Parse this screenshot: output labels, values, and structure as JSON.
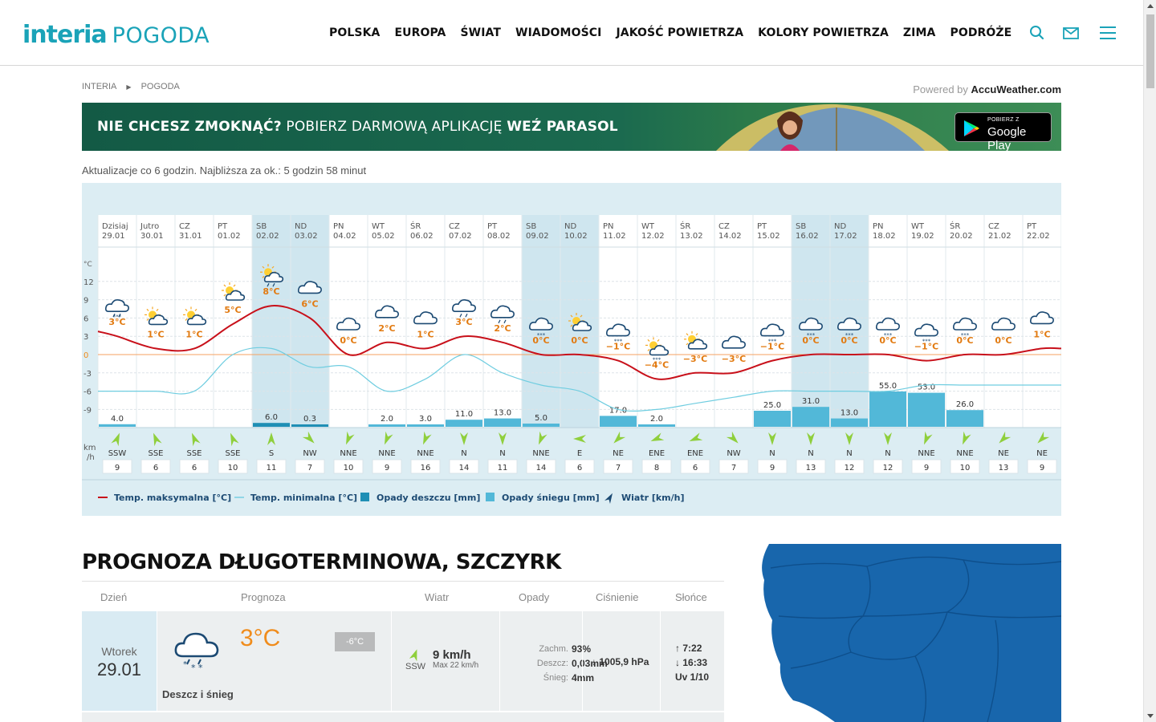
{
  "header": {
    "logo_brand": "interia",
    "logo_section": "POGODA",
    "nav": [
      "POLSKA",
      "EUROPA",
      "ŚWIAT",
      "WIADOMOŚCI",
      "JAKOŚĆ POWIETRZA",
      "KOLORY POWIETRZA",
      "ZIMA",
      "PODRÓŻE"
    ],
    "icons": [
      "search-icon",
      "mail-icon",
      "menu-icon"
    ]
  },
  "breadcrumb": [
    "INTERIA",
    "POGODA"
  ],
  "powered_by": {
    "prefix": "Powered by",
    "brand": "AccuWeather.com"
  },
  "banner": {
    "text_bold1": "NIE CHCESZ ZMOKNĄĆ?",
    "text_normal": "POBIERZ DARMOWĄ APLIKACJĘ",
    "text_bold2": "WEŹ PARASOL",
    "store_small": "POBIERZ Z",
    "store_big": "Google Play"
  },
  "updates_text": "Aktualizacje co 6 godzin. Najbliższa za ok.: 5 godzin 58 minut",
  "colors": {
    "max_line": "#c8101a",
    "min_line": "#6fcde0",
    "rain_bar": "#1f8fb5",
    "snow_bar": "#52b8d8",
    "accent": "#1aa3b8",
    "weekend_col": "#cfe6ef"
  },
  "chart_data": {
    "type": "line",
    "temp_unit": "°C",
    "wind_unit_1": "km",
    "wind_unit_2": "/h",
    "y_ticks": [
      "12",
      "9",
      "6",
      "3",
      "0",
      "-3",
      "-6",
      "-9"
    ],
    "ylim": [
      -12,
      15
    ],
    "days": [
      {
        "d": "Dzisiaj",
        "date": "29.01",
        "max": 3,
        "min": -6,
        "label": "3°C",
        "icon": "rain-snow-icon",
        "precip": 4.0,
        "ptype": "snow",
        "wdir": "SSW",
        "wspd": 9,
        "weekend": false
      },
      {
        "d": "Jutro",
        "date": "30.01",
        "max": 1,
        "min": -6,
        "label": "1°C",
        "icon": "partly-sunny-icon",
        "precip": 0,
        "ptype": "none",
        "wdir": "SSE",
        "wspd": 6,
        "weekend": false
      },
      {
        "d": "CZ",
        "date": "31.01",
        "max": 1,
        "min": -6,
        "label": "1°C",
        "icon": "partly-sunny-icon",
        "precip": 0,
        "ptype": "none",
        "wdir": "SSE",
        "wspd": 6,
        "weekend": false
      },
      {
        "d": "PT",
        "date": "01.02",
        "max": 5,
        "min": 0,
        "label": "5°C",
        "icon": "partly-sunny-icon",
        "precip": 0,
        "ptype": "none",
        "wdir": "SSE",
        "wspd": 10,
        "weekend": false
      },
      {
        "d": "SB",
        "date": "02.02",
        "max": 8,
        "min": 1,
        "label": "8°C",
        "icon": "sun-rain-icon",
        "precip": 6.0,
        "ptype": "rain",
        "wdir": "S",
        "wspd": 11,
        "weekend": true
      },
      {
        "d": "ND",
        "date": "03.02",
        "max": 6,
        "min": -2,
        "label": "6°C",
        "icon": "cloudy-icon",
        "precip": 0.3,
        "ptype": "rain",
        "wdir": "NW",
        "wspd": 7,
        "weekend": true
      },
      {
        "d": "PN",
        "date": "04.02",
        "max": 0,
        "min": -2,
        "label": "0°C",
        "icon": "cloudy-icon",
        "precip": 0,
        "ptype": "none",
        "wdir": "NNE",
        "wspd": 10,
        "weekend": false
      },
      {
        "d": "WT",
        "date": "05.02",
        "max": 2,
        "min": -6,
        "label": "2°C",
        "icon": "cloudy-icon",
        "precip": 2.0,
        "ptype": "snow",
        "wdir": "NNE",
        "wspd": 9,
        "weekend": false
      },
      {
        "d": "ŚR",
        "date": "06.02",
        "max": 1,
        "min": -4,
        "label": "1°C",
        "icon": "cloudy-icon",
        "precip": 3.0,
        "ptype": "snow",
        "wdir": "NNE",
        "wspd": 16,
        "weekend": false
      },
      {
        "d": "CZ",
        "date": "07.02",
        "max": 3,
        "min": 0,
        "label": "3°C",
        "icon": "rain-icon",
        "precip": 11.0,
        "ptype": "snow",
        "wdir": "N",
        "wspd": 14,
        "weekend": false
      },
      {
        "d": "PT",
        "date": "08.02",
        "max": 2,
        "min": -3,
        "label": "2°C",
        "icon": "rain-icon",
        "precip": 13.0,
        "ptype": "snow",
        "wdir": "N",
        "wspd": 11,
        "weekend": false
      },
      {
        "d": "SB",
        "date": "09.02",
        "max": 0,
        "min": -5,
        "label": "0°C",
        "icon": "snow-icon",
        "precip": 5.0,
        "ptype": "snow",
        "wdir": "NNE",
        "wspd": 14,
        "weekend": true
      },
      {
        "d": "ND",
        "date": "10.02",
        "max": 0,
        "min": -6,
        "label": "0°C",
        "icon": "partly-sunny-icon",
        "precip": 0,
        "ptype": "none",
        "wdir": "E",
        "wspd": 6,
        "weekend": true
      },
      {
        "d": "PN",
        "date": "11.02",
        "max": -1,
        "min": -9,
        "label": "−1°C",
        "icon": "snow-icon",
        "precip": 17.0,
        "ptype": "snow",
        "wdir": "NE",
        "wspd": 7,
        "weekend": false
      },
      {
        "d": "WT",
        "date": "12.02",
        "max": -4,
        "min": -9,
        "label": "−4°C",
        "icon": "sun-snow-icon",
        "precip": 2.0,
        "ptype": "snow",
        "wdir": "ENE",
        "wspd": 8,
        "weekend": false
      },
      {
        "d": "ŚR",
        "date": "13.02",
        "max": -3,
        "min": -8,
        "label": "−3°C",
        "icon": "partly-sunny-icon",
        "precip": 0,
        "ptype": "none",
        "wdir": "ENE",
        "wspd": 6,
        "weekend": false
      },
      {
        "d": "CZ",
        "date": "14.02",
        "max": -3,
        "min": -7,
        "label": "−3°C",
        "icon": "cloudy-icon",
        "precip": 0,
        "ptype": "none",
        "wdir": "NW",
        "wspd": 7,
        "weekend": false
      },
      {
        "d": "PT",
        "date": "15.02",
        "max": -1,
        "min": -6,
        "label": "−1°C",
        "icon": "snow-icon",
        "precip": 25.0,
        "ptype": "snow",
        "wdir": "N",
        "wspd": 9,
        "weekend": false
      },
      {
        "d": "SB",
        "date": "16.02",
        "max": 0,
        "min": -6,
        "label": "0°C",
        "icon": "snow-icon",
        "precip": 31.0,
        "ptype": "snow",
        "wdir": "N",
        "wspd": 13,
        "weekend": true
      },
      {
        "d": "ND",
        "date": "17.02",
        "max": 0,
        "min": -6,
        "label": "0°C",
        "icon": "snow-icon",
        "precip": 13.0,
        "ptype": "snow",
        "wdir": "N",
        "wspd": 12,
        "weekend": true
      },
      {
        "d": "PN",
        "date": "18.02",
        "max": 0,
        "min": -6,
        "label": "0°C",
        "icon": "snow-icon",
        "precip": 55.0,
        "ptype": "snow",
        "wdir": "N",
        "wspd": 12,
        "weekend": false
      },
      {
        "d": "WT",
        "date": "19.02",
        "max": -1,
        "min": -5,
        "label": "−1°C",
        "icon": "snow-icon",
        "precip": 53.0,
        "ptype": "snow",
        "wdir": "NNE",
        "wspd": 9,
        "weekend": false
      },
      {
        "d": "ŚR",
        "date": "20.02",
        "max": 0,
        "min": -5,
        "label": "0°C",
        "icon": "snow-icon",
        "precip": 26.0,
        "ptype": "snow",
        "wdir": "NNE",
        "wspd": 10,
        "weekend": false
      },
      {
        "d": "CZ",
        "date": "21.02",
        "max": 0,
        "min": -5,
        "label": "0°C",
        "icon": "cloudy-icon",
        "precip": 0,
        "ptype": "none",
        "wdir": "NE",
        "wspd": 13,
        "weekend": false
      },
      {
        "d": "PT",
        "date": "22.02",
        "max": 1,
        "min": -5,
        "label": "1°C",
        "icon": "cloudy-icon",
        "precip": 0,
        "ptype": "none",
        "wdir": "NE",
        "wspd": 9,
        "weekend": false
      }
    ],
    "legend": [
      {
        "label": "Temp. maksymalna [°C]",
        "kind": "line-max"
      },
      {
        "label": "Temp. minimalna [°C]",
        "kind": "line-min"
      },
      {
        "label": "Opady deszczu [mm]",
        "kind": "rain"
      },
      {
        "label": "Opady śniegu [mm]",
        "kind": "snow"
      },
      {
        "label": "Wiatr [km/h]",
        "kind": "wind"
      }
    ]
  },
  "longterm": {
    "title": "PROGNOZA DŁUGOTERMINOWA, SZCZYRK",
    "headers": [
      "Dzień",
      "Prognoza",
      "Wiatr",
      "Opady",
      "Ciśnienie",
      "Słońce"
    ],
    "row": {
      "weekday": "Wtorek",
      "date": "29.01",
      "temp": "3°C",
      "temp_min": "-6°C",
      "desc": "Deszcz i śnieg",
      "wind_speed": "9 km/h",
      "wind_max": "Max 22 km/h",
      "wind_dir": "SSW",
      "cloud_label": "Zachm.",
      "cloud_val": "93%",
      "rain_label": "Deszcz:",
      "rain_val": "0,03mm",
      "snow_label": "Śnieg:",
      "snow_val": "4mm",
      "pressure": "1005,9 hPa",
      "sunrise": "7:22",
      "sunset": "16:33",
      "uv": "Uv 1/10"
    }
  }
}
